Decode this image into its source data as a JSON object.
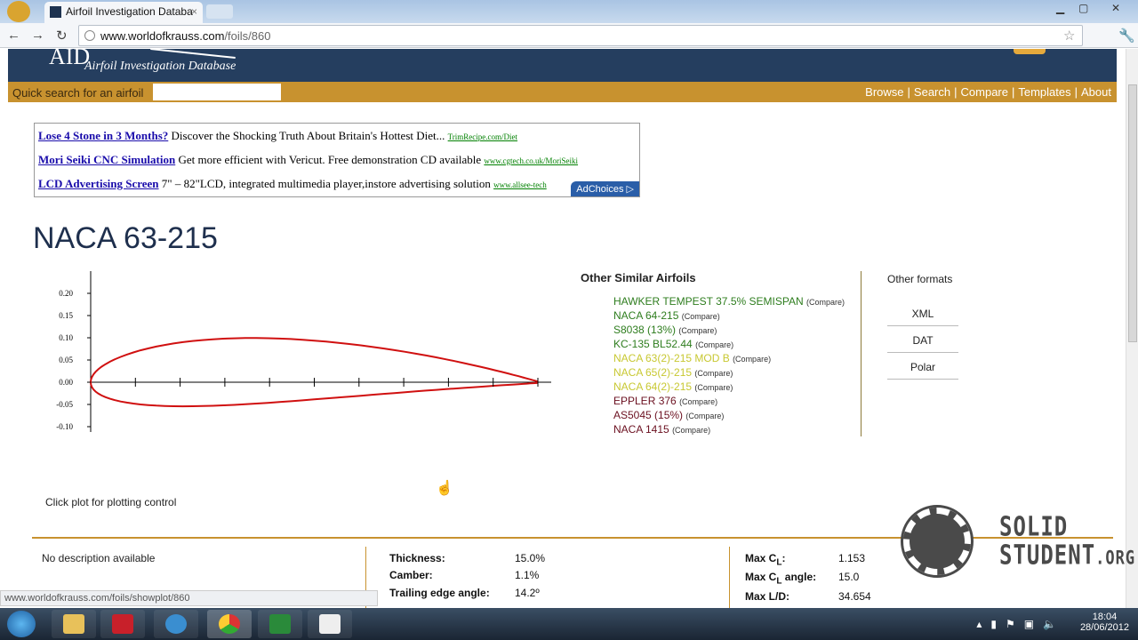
{
  "browser": {
    "tab_title": "Airfoil Investigation Databa",
    "url_host": "www.worldofkrauss.com",
    "url_path": "/foils/860",
    "status_url": "www.worldofkrauss.com/foils/showplot/860"
  },
  "site": {
    "logo": "AID",
    "subtitle": "Airfoil Investigation Database",
    "quick_search_label": "Quick search for an airfoil",
    "quick_search_value": "",
    "menu": [
      "Browse",
      "Search",
      "Compare",
      "Templates",
      "About"
    ]
  },
  "ads": [
    {
      "link": "Lose 4 Stone in 3 Months?",
      "text": "Discover the Shocking Truth About Britain's Hottest Diet...",
      "url": "TrimRecipe.com/Diet"
    },
    {
      "link": "Mori Seiki CNC Simulation",
      "text": "Get more efficient with Vericut. Free demonstration CD available",
      "url": "www.cgtech.co.uk/MoriSeiki"
    },
    {
      "link": "LCD Advertising Screen",
      "text": "7\" – 82\"LCD, integrated multimedia player,instore advertising solution",
      "url": "www.allsee-tech"
    }
  ],
  "adchoices": "AdChoices ▷",
  "airfoil": {
    "name": "NACA 63-215",
    "plot_hint": "Click plot for plotting control",
    "description": "No description available",
    "y_ticks": [
      "0.20",
      "0.15",
      "0.10",
      "0.05",
      "0.00",
      "-0.05",
      "-0.10"
    ],
    "thickness_label": "Thickness:",
    "thickness": "15.0%",
    "camber_label": "Camber:",
    "camber": "1.1%",
    "te_label": "Trailing edge angle:",
    "te_angle": "14.2º",
    "maxcl_label": "Max C",
    "maxcl": "1.153",
    "maxcl_angle_label": "Max C",
    "maxcl_angle_suffix": " angle:",
    "maxcl_angle": "15.0",
    "maxld_label": "Max L/D:",
    "maxld": "34.654",
    "sub_l": "L"
  },
  "similar": {
    "title": "Other Similar Airfoils",
    "compare": "(Compare)",
    "items": [
      {
        "name": "HAWKER TEMPEST 37.5% SEMISPAN",
        "color": "#2e7d1e"
      },
      {
        "name": "NACA 64-215",
        "color": "#2e7d1e"
      },
      {
        "name": "S8038 (13%)",
        "color": "#2e7d1e"
      },
      {
        "name": "KC-135 BL52.44",
        "color": "#2e7d1e"
      },
      {
        "name": "NACA 63(2)-215 MOD B",
        "color": "#c8c832"
      },
      {
        "name": "NACA 65(2)-215",
        "color": "#c8c832"
      },
      {
        "name": "NACA 64(2)-215",
        "color": "#c8c832"
      },
      {
        "name": "EPPLER 376",
        "color": "#6b1020"
      },
      {
        "name": "AS5045 (15%)",
        "color": "#6b1020"
      },
      {
        "name": "NACA 1415",
        "color": "#6b1020"
      }
    ]
  },
  "formats": {
    "title": "Other formats",
    "items": [
      "XML",
      "DAT",
      "Polar"
    ]
  },
  "watermark": {
    "line1": "SOLID",
    "line2": "STUDENT",
    "suffix": ".ORG"
  },
  "clock": {
    "time": "18:04",
    "date": "28/06/2012"
  }
}
